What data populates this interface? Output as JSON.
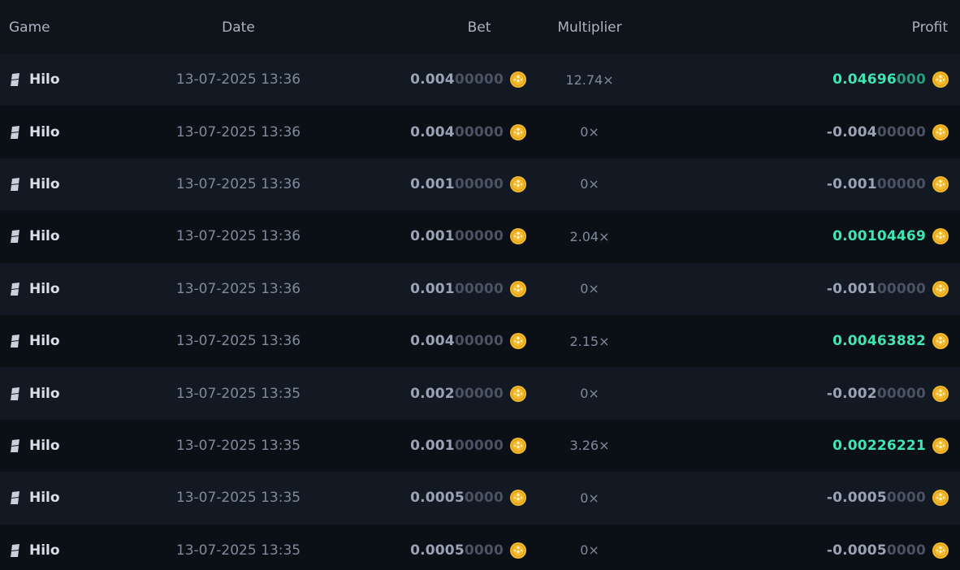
{
  "header": {
    "game": "Game",
    "date": "Date",
    "bet": "Bet",
    "multiplier": "Multiplier",
    "profit": "Profit"
  },
  "colors": {
    "win": "#3ee6b0",
    "coin": "#f3ba2f"
  },
  "rows": [
    {
      "game": "Hilo",
      "date": "13-07-2025 13:36",
      "bet_strong": "0.004",
      "bet_dim": "00000",
      "multiplier": "12.74×",
      "profit_strong": "0.04696",
      "profit_dim": "000",
      "win": true
    },
    {
      "game": "Hilo",
      "date": "13-07-2025 13:36",
      "bet_strong": "0.004",
      "bet_dim": "00000",
      "multiplier": "0×",
      "profit_strong": "-0.004",
      "profit_dim": "00000",
      "win": false
    },
    {
      "game": "Hilo",
      "date": "13-07-2025 13:36",
      "bet_strong": "0.001",
      "bet_dim": "00000",
      "multiplier": "0×",
      "profit_strong": "-0.001",
      "profit_dim": "00000",
      "win": false
    },
    {
      "game": "Hilo",
      "date": "13-07-2025 13:36",
      "bet_strong": "0.001",
      "bet_dim": "00000",
      "multiplier": "2.04×",
      "profit_strong": "0.00104469",
      "profit_dim": "",
      "win": true
    },
    {
      "game": "Hilo",
      "date": "13-07-2025 13:36",
      "bet_strong": "0.001",
      "bet_dim": "00000",
      "multiplier": "0×",
      "profit_strong": "-0.001",
      "profit_dim": "00000",
      "win": false
    },
    {
      "game": "Hilo",
      "date": "13-07-2025 13:36",
      "bet_strong": "0.004",
      "bet_dim": "00000",
      "multiplier": "2.15×",
      "profit_strong": "0.00463882",
      "profit_dim": "",
      "win": true
    },
    {
      "game": "Hilo",
      "date": "13-07-2025 13:35",
      "bet_strong": "0.002",
      "bet_dim": "00000",
      "multiplier": "0×",
      "profit_strong": "-0.002",
      "profit_dim": "00000",
      "win": false
    },
    {
      "game": "Hilo",
      "date": "13-07-2025 13:35",
      "bet_strong": "0.001",
      "bet_dim": "00000",
      "multiplier": "3.26×",
      "profit_strong": "0.00226221",
      "profit_dim": "",
      "win": true
    },
    {
      "game": "Hilo",
      "date": "13-07-2025 13:35",
      "bet_strong": "0.0005",
      "bet_dim": "0000",
      "multiplier": "0×",
      "profit_strong": "-0.0005",
      "profit_dim": "0000",
      "win": false
    },
    {
      "game": "Hilo",
      "date": "13-07-2025 13:35",
      "bet_strong": "0.0005",
      "bet_dim": "0000",
      "multiplier": "0×",
      "profit_strong": "-0.0005",
      "profit_dim": "0000",
      "win": false
    }
  ]
}
